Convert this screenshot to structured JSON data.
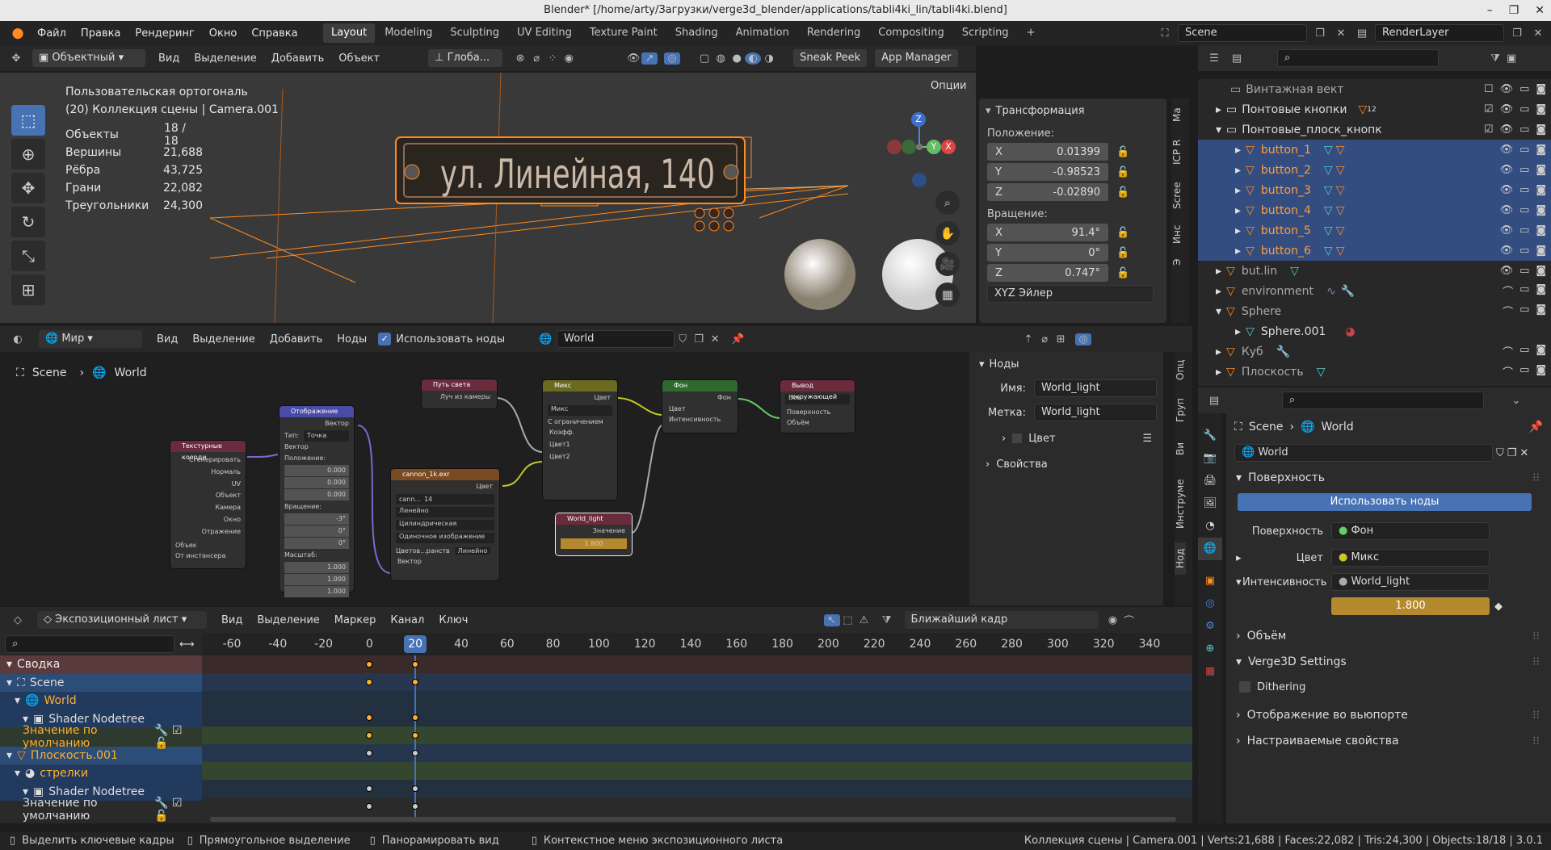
{
  "window": {
    "title": "Blender* [/home/arty/Загрузки/verge3d_blender/applications/tabli4ki_lin/tabli4ki.blend]"
  },
  "topmenu": [
    "Файл",
    "Правка",
    "Рендеринг",
    "Окно",
    "Справка"
  ],
  "workspaces": [
    "Layout",
    "Modeling",
    "Sculpting",
    "UV Editing",
    "Texture Paint",
    "Shading",
    "Animation",
    "Rendering",
    "Compositing",
    "Scripting"
  ],
  "scene_name": "Scene",
  "render_layer": "RenderLayer",
  "viewport": {
    "mode": "Объектный",
    "menus": [
      "Вид",
      "Выделение",
      "Добавить",
      "Объект"
    ],
    "orientation": "Глоба...",
    "sneak": "Sneak Peek",
    "appmgr": "App Manager",
    "options": "Опции",
    "view_name": "Пользовательская ортогональ",
    "collection": "(20) Коллекция сцены | Camera.001",
    "stats": [
      {
        "k": "Объекты",
        "v": "18 / 18"
      },
      {
        "k": "Вершины",
        "v": "21,688"
      },
      {
        "k": "Рёбра",
        "v": "43,725"
      },
      {
        "k": "Грани",
        "v": "22,082"
      },
      {
        "k": "Треугольники",
        "v": "24,300"
      }
    ],
    "sign_text": "ул. Линейная, 140",
    "gizmo": {
      "x": "X",
      "y": "Y",
      "z": "Z"
    }
  },
  "transform": {
    "title": "Трансформация",
    "pos_label": "Положение:",
    "pos": [
      {
        "a": "X",
        "v": "0.01399"
      },
      {
        "a": "Y",
        "v": "-0.98523"
      },
      {
        "a": "Z",
        "v": "-0.02890"
      }
    ],
    "rot_label": "Вращение:",
    "rot": [
      {
        "a": "X",
        "v": "91.4°"
      },
      {
        "a": "Y",
        "v": "0°"
      },
      {
        "a": "Z",
        "v": "0.747°"
      }
    ],
    "euler": "XYZ Эйлер",
    "tabs": [
      "Ма",
      "ICP R",
      "Scree",
      "Инс",
      "Э"
    ]
  },
  "outliner": {
    "rows": [
      {
        "name": "Винтажная вект",
        "indent": 1,
        "sel": false
      },
      {
        "name": "Понтовые кнопки",
        "indent": 1,
        "sel": false,
        "badge": "12"
      },
      {
        "name": "Понтовые_плоск_кнопк",
        "indent": 1,
        "sel": false
      },
      {
        "name": "button_1",
        "indent": 2,
        "sel": true
      },
      {
        "name": "button_2",
        "indent": 2,
        "sel": true
      },
      {
        "name": "button_3",
        "indent": 2,
        "sel": true
      },
      {
        "name": "button_4",
        "indent": 2,
        "sel": true
      },
      {
        "name": "button_5",
        "indent": 2,
        "sel": true
      },
      {
        "name": "button_6",
        "indent": 2,
        "sel": true
      },
      {
        "name": "but.lin",
        "indent": 1,
        "sel": false
      },
      {
        "name": "environment",
        "indent": 1,
        "sel": false
      },
      {
        "name": "Sphere",
        "indent": 1,
        "sel": false
      },
      {
        "name": "Sphere.001",
        "indent": 2,
        "sel": false
      },
      {
        "name": "Куб",
        "indent": 1,
        "sel": false
      },
      {
        "name": "Плоскость",
        "indent": 1,
        "sel": false
      }
    ]
  },
  "node_editor": {
    "world_label": "Мир",
    "menus": [
      "Вид",
      "Выделение",
      "Добавить",
      "Ноды"
    ],
    "use_nodes": "Использовать ноды",
    "world_name": "World",
    "breadcrumb": [
      "Scene",
      "World"
    ],
    "panel": {
      "title": "Ноды",
      "name_label": "Имя:",
      "name_val": "World_light",
      "label_label": "Метка:",
      "label_val": "World_light",
      "color": "Цвет",
      "props": "Свойства"
    },
    "tabs": [
      "Опц",
      "Груп",
      "Ви",
      "Инструме",
      "Нод"
    ],
    "nodes": {
      "texcoord": {
        "title": "Текстурные коорди",
        "out": [
          "Сгенерировать",
          "Нормаль",
          "UV",
          "Объект",
          "Камера",
          "Окно",
          "Отражение"
        ],
        "obj": "Объек",
        "inst": "От инстансера"
      },
      "mapping": {
        "title": "Отображение",
        "out": "Вектор",
        "type_l": "Тип:",
        "type_v": "Точка",
        "vec": "Вектор",
        "pos": "Положение:",
        "rot": "Вращение:",
        "scale": "Масштаб:",
        "pv": [
          "0.000",
          "0.000",
          "0.000"
        ],
        "rv": [
          "-3°",
          "0°",
          "0°"
        ],
        "sv": [
          "1.000",
          "1.000",
          "1.000"
        ]
      },
      "lightpath": {
        "title": "Путь света",
        "out": "Луч из камеры"
      },
      "mix": {
        "title": "Микс",
        "out": "Цвет",
        "mode": "Микс",
        "clamp": "С ограничением",
        "fac": "Коэфф.",
        "c1": "Цвет1",
        "c2": "Цвет2"
      },
      "bg": {
        "title": "Фон",
        "out": "Фон",
        "c": "Цвет",
        "s": "Интенсивность"
      },
      "output": {
        "title": "Вывод окружающей",
        "all": "Все",
        "surf": "Поверхность",
        "vol": "Объём"
      },
      "image": {
        "title": "cannon_1k.exr",
        "out": "Цвет",
        "img": "cann...",
        "num": "14",
        "o1": "Линейно",
        "o2": "Цилиндрическая",
        "o3": "Одиночное изображение",
        "cs_l": "Цветов...ранств",
        "cs_v": "Линейно",
        "vec": "Вектор"
      },
      "value": {
        "title": "World_light",
        "out": "Значение",
        "val": "1.800"
      }
    }
  },
  "dopesheet": {
    "mode": "Экспозиционный лист",
    "menus": [
      "Вид",
      "Выделение",
      "Маркер",
      "Канал",
      "Ключ"
    ],
    "snap": "Ближайший кадр",
    "current": "20",
    "ticks": [
      "-60",
      "-40",
      "-20",
      "0",
      "20",
      "40",
      "60",
      "80",
      "100",
      "120",
      "140",
      "160",
      "180",
      "200",
      "220",
      "240",
      "260",
      "280",
      "300",
      "320",
      "340"
    ],
    "channels": [
      {
        "name": "Сводка",
        "lvl": 0,
        "kind": "summary"
      },
      {
        "name": "Scene",
        "lvl": 0,
        "kind": "scene"
      },
      {
        "name": "World",
        "lvl": 1,
        "kind": "obj"
      },
      {
        "name": "Shader Nodetree",
        "lvl": 2,
        "kind": "obj"
      },
      {
        "name": "Значение по умолчанию",
        "lvl": 0,
        "kind": "fcurve"
      },
      {
        "name": "Плоскость.001",
        "lvl": 0,
        "kind": "scene"
      },
      {
        "name": "стрелки",
        "lvl": 1,
        "kind": "obj"
      },
      {
        "name": "Shader Nodetree",
        "lvl": 2,
        "kind": "obj"
      },
      {
        "name": "Значение по умолчанию",
        "lvl": 0,
        "kind": "fcurve2"
      }
    ]
  },
  "properties": {
    "breadcrumb": [
      "Scene",
      "World"
    ],
    "world": "World",
    "surface_sec": "Поверхность",
    "use_nodes": "Использовать ноды",
    "surface_l": "Поверхность",
    "surface_v": "Фон",
    "color_l": "Цвет",
    "color_v": "Микс",
    "strength_l": "Интенсивность",
    "strength_v": "World_light",
    "value": "1.800",
    "sections": [
      "Объём",
      "Verge3D Settings"
    ],
    "dithering": "Dithering",
    "sections2": [
      "Отображение во вьюпорте",
      "Настраиваемые свойства"
    ]
  },
  "statusbar": {
    "items": [
      "Выделить ключевые кадры",
      "Прямоугольное выделение",
      "Панорамировать вид",
      "Контекстное меню экспозиционного листа"
    ],
    "right": "Коллекция сцены | Camera.001 | Verts:21,688 | Faces:22,082 | Tris:24,300 | Objects:18/18 | 3.0.1"
  },
  "colors": {
    "accent": "#4772b3",
    "select": "#334d80",
    "orange": "#ff8a1e",
    "yellow": "#b58a2e"
  }
}
